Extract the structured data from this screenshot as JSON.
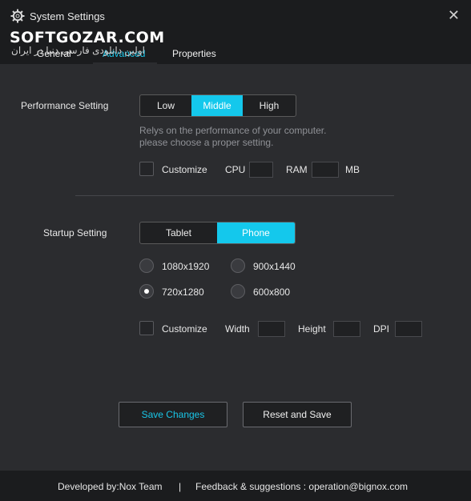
{
  "window": {
    "title": "System Settings",
    "icon": "gear-icon",
    "close_symbol": "✕"
  },
  "watermark": {
    "text": "SOFTGOZAR.COM",
    "subtitle": "اولین دانلودی فارسی دنیا در ایران"
  },
  "tabs": [
    {
      "label": "General",
      "active": false
    },
    {
      "label": "Advanced",
      "active": true
    },
    {
      "label": "Properties",
      "active": false
    }
  ],
  "performance": {
    "label": "Performance Setting",
    "options": [
      "Low",
      "Middle",
      "High"
    ],
    "selected": "Middle",
    "hint_line1": "Relys on the performance of your computer.",
    "hint_line2": "please choose a proper setting.",
    "customize_label": "Customize",
    "cpu_label": "CPU",
    "ram_label": "RAM",
    "ram_unit": "MB",
    "customize_checked": false
  },
  "startup": {
    "label": "Startup Setting",
    "options": [
      "Tablet",
      "Phone"
    ],
    "selected": "Phone",
    "resolutions": [
      {
        "label": "1080x1920",
        "selected": false
      },
      {
        "label": "900x1440",
        "selected": false
      },
      {
        "label": "720x1280",
        "selected": true
      },
      {
        "label": "600x800",
        "selected": false
      }
    ],
    "customize_label": "Customize",
    "width_label": "Width",
    "height_label": "Height",
    "dpi_label": "DPI",
    "customize_checked": false
  },
  "buttons": {
    "save": "Save Changes",
    "reset": "Reset and Save"
  },
  "footer": {
    "developer": "Developed by:Nox Team",
    "separator": "|",
    "feedback": "Feedback & suggestions : operation@bignox.com"
  },
  "colors": {
    "accent": "#14c8ec",
    "background": "#2b2c2f",
    "titlebar": "#1b1c1e"
  }
}
